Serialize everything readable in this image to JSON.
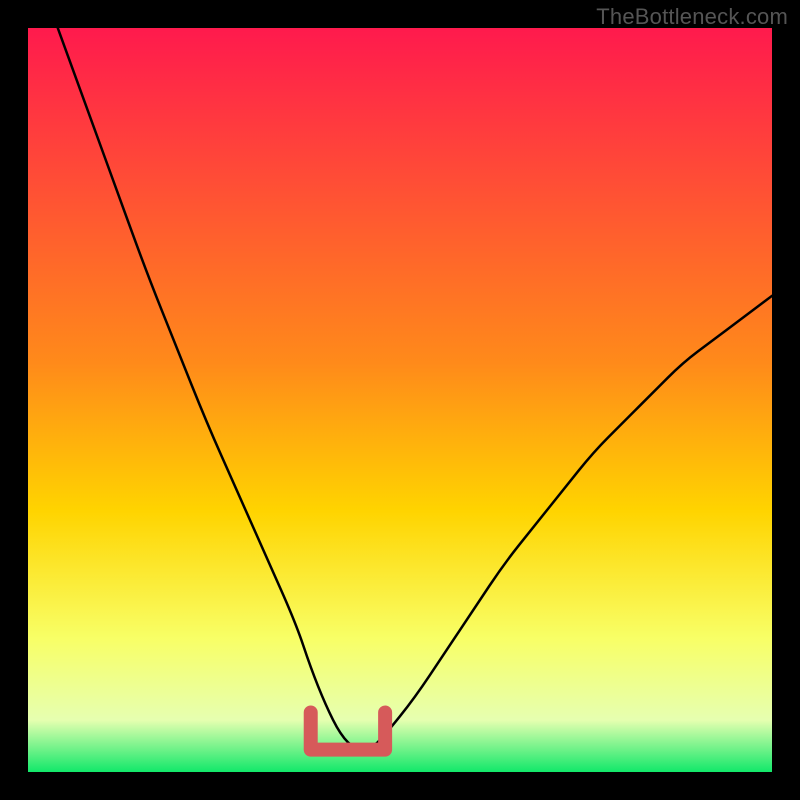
{
  "watermark": "TheBottleneck.com",
  "colors": {
    "frame": "#000000",
    "grad_top": "#ff1a4d",
    "grad_mid": "#ffd400",
    "grad_low": "#f8ff66",
    "grad_bottom": "#12e86a",
    "curve": "#000000",
    "marker": "#d65a5a"
  },
  "chart_data": {
    "type": "line",
    "title": "",
    "xlabel": "",
    "ylabel": "",
    "xlim": [
      0,
      100
    ],
    "ylim": [
      0,
      100
    ],
    "series": [
      {
        "name": "bottleneck-curve",
        "x": [
          4,
          8,
          12,
          16,
          20,
          24,
          28,
          32,
          36,
          38,
          40,
          42,
          44,
          46,
          48,
          52,
          56,
          60,
          64,
          68,
          72,
          76,
          80,
          84,
          88,
          92,
          96,
          100
        ],
        "y": [
          100,
          89,
          78,
          67,
          57,
          47,
          38,
          29,
          20,
          14,
          9,
          5,
          3,
          3,
          5,
          10,
          16,
          22,
          28,
          33,
          38,
          43,
          47,
          51,
          55,
          58,
          61,
          64
        ]
      }
    ],
    "annotations": [
      {
        "name": "optimal-range-marker",
        "x_range": [
          38,
          48
        ],
        "y": 3
      }
    ]
  }
}
